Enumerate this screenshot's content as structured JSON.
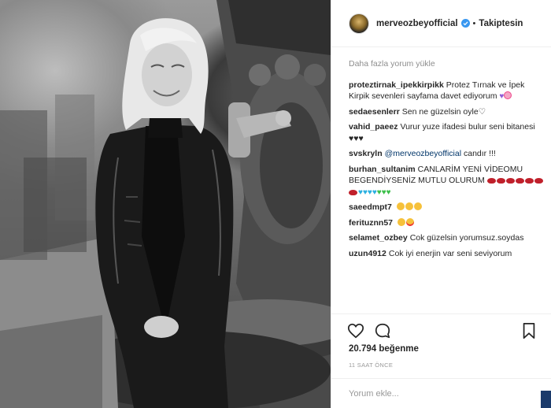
{
  "post": {
    "username": "merveozbeyofficial",
    "separator": "•",
    "follow_label": "Takiptesin",
    "load_more": "Daha fazla yorum yükle",
    "likes": "20.794 beğenme",
    "time": "11 SAAT ÖNCE",
    "comment_placeholder": "Yorum ekle..."
  },
  "comments": [
    {
      "user": "proteztirnak_ipekkirpikk",
      "text": "Protez Tırnak ve İpek Kirpik sevenleri sayfama davet ediyorum",
      "emoji": [
        "purple-heart",
        "cherry-blossom"
      ]
    },
    {
      "user": "sedaesenlerr",
      "text": "Sen ne güzelsin oyle♡",
      "emoji": []
    },
    {
      "user": "vahid_paeez",
      "text": "Vurur yuze ifadesi bulur seni bitanesi ♥♥♥",
      "emoji": []
    },
    {
      "user": "svskryln",
      "mention": "@merveozbeyofficial",
      "text": " candır !!!",
      "emoji": []
    },
    {
      "user": "burhan_sultanim",
      "text": "CANLARİM YENİ VİDEOMU BEGENDİYSENİZ MUTLU OLURUM",
      "emoji": [
        "kiss",
        "kiss",
        "kiss",
        "kiss",
        "kiss",
        "kiss",
        "kiss",
        "blue-heart",
        "blue-heart",
        "blue-heart",
        "blue-heart",
        "green-heart",
        "green-heart",
        "green-heart"
      ]
    },
    {
      "user": "saeedmpt7",
      "text": "",
      "emoji": [
        "grin",
        "grin",
        "grin"
      ]
    },
    {
      "user": "ferituznn57",
      "text": "",
      "emoji": [
        "smile",
        "heart-eyes"
      ]
    },
    {
      "user": "selamet_ozbey",
      "text": "Cok güzelsin yorumsuz.soydas",
      "emoji": []
    },
    {
      "user": "uzun4912",
      "text": "Cok iyi enerjin var seni seviyorum",
      "emoji": []
    }
  ],
  "icons": {
    "like": "heart-outline-icon",
    "comment": "comment-bubble-icon",
    "save": "bookmark-icon",
    "verified": "verified-badge-icon"
  },
  "colors": {
    "verified": "#3897f0",
    "mention": "#003569",
    "muted": "#8e8e8e"
  }
}
